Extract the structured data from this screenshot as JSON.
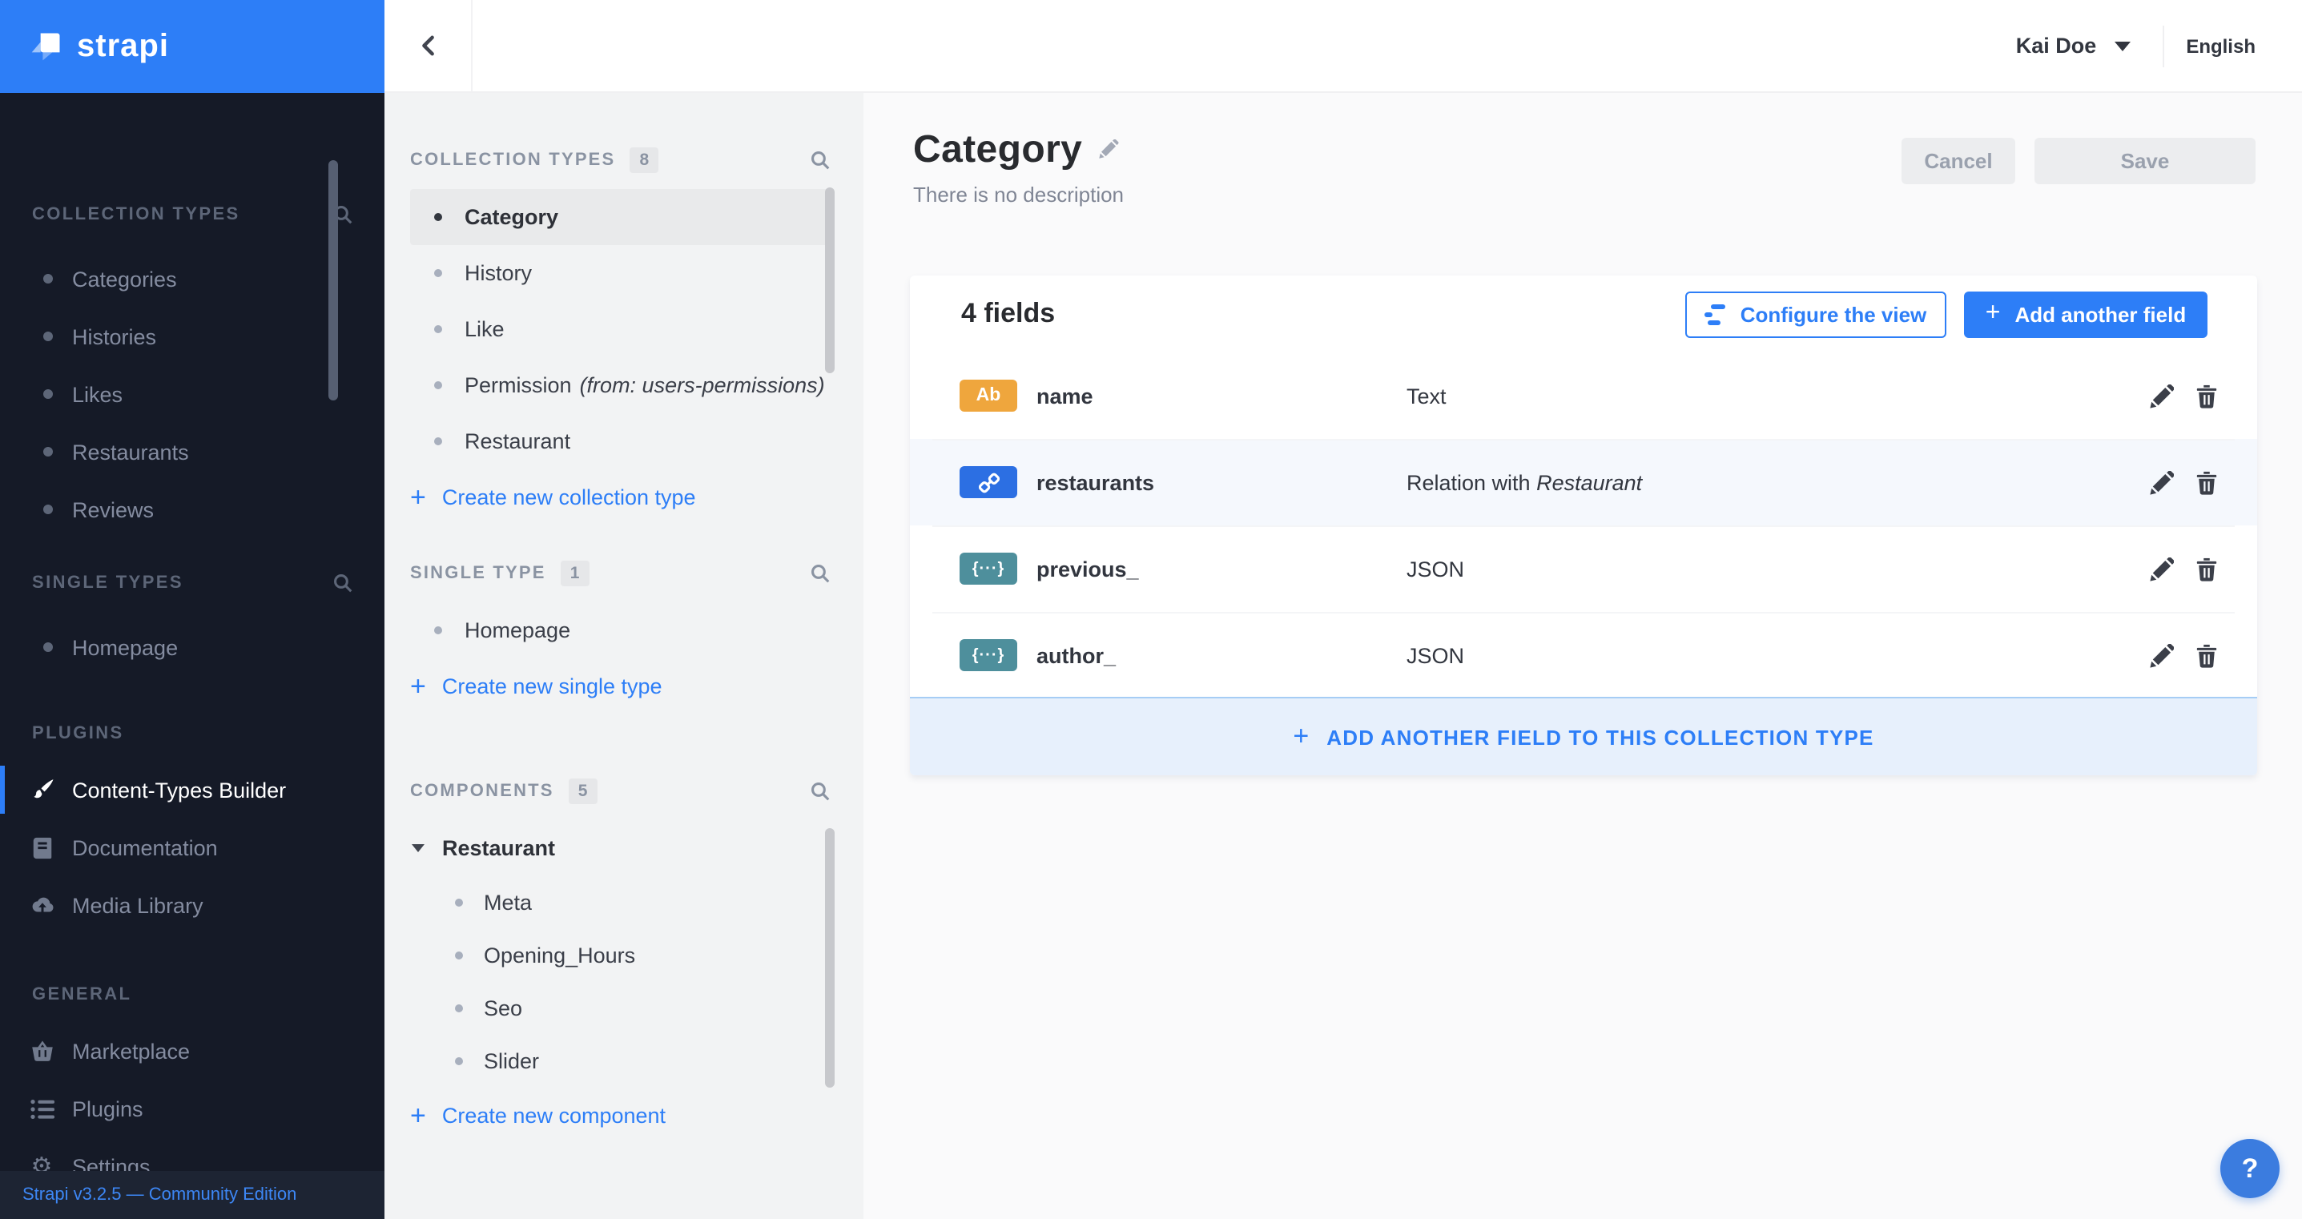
{
  "colors": {
    "accent_blue": "#2d7ef7",
    "dark_sidebar_bg": "#151a27",
    "builder_sidebar_bg": "#f2f3f4",
    "main_bg": "#fafafb",
    "badge_text_field": "#efa63d",
    "badge_relation": "#2c6fe3",
    "badge_json": "#4e8f9c"
  },
  "app_sidebar": {
    "logo_text": "strapi",
    "sections": [
      {
        "title": "COLLECTION TYPES",
        "items": [
          "Categories",
          "Histories",
          "Likes",
          "Restaurants",
          "Reviews"
        ]
      },
      {
        "title": "SINGLE TYPES",
        "items": [
          "Homepage"
        ]
      },
      {
        "title": "PLUGINS",
        "items": [
          {
            "label": "Content-Types Builder",
            "icon": "brush",
            "active": true
          },
          {
            "label": "Documentation",
            "icon": "book"
          },
          {
            "label": "Media Library",
            "icon": "cloud-upload"
          }
        ]
      },
      {
        "title": "GENERAL",
        "items": [
          {
            "label": "Marketplace",
            "icon": "basket"
          },
          {
            "label": "Plugins",
            "icon": "list"
          },
          {
            "label": "Settings",
            "icon": "gear"
          }
        ]
      }
    ],
    "footer": "Strapi v3.2.5 — Community Edition"
  },
  "topbar": {
    "user": "Kai Doe",
    "language": "English"
  },
  "builder": {
    "collection": {
      "title": "COLLECTION TYPES",
      "count": "8",
      "items": [
        {
          "label": "Category",
          "active": true
        },
        {
          "label": "History"
        },
        {
          "label": "Like"
        },
        {
          "label": "Permission",
          "note": "(from: users-permissions)"
        },
        {
          "label": "Restaurant"
        }
      ],
      "create": "Create new collection type"
    },
    "single": {
      "title": "SINGLE TYPE",
      "count": "1",
      "items": [
        {
          "label": "Homepage"
        }
      ],
      "create": "Create new single type"
    },
    "components": {
      "title": "COMPONENTS",
      "count": "5",
      "group": "Restaurant",
      "items": [
        {
          "label": "Meta"
        },
        {
          "label": "Opening_Hours"
        },
        {
          "label": "Seo"
        },
        {
          "label": "Slider"
        }
      ],
      "create": "Create new component"
    }
  },
  "main": {
    "title": "Category",
    "subtitle": "There is no description",
    "cancel_label": "Cancel",
    "save_label": "Save",
    "fields_count": "4 fields",
    "configure_label": "Configure the view",
    "add_field_label": "Add another field",
    "rows": [
      {
        "badge": "Ab",
        "badge_type": "text",
        "name": "name",
        "type": "Text"
      },
      {
        "badge_type": "relation",
        "name": "restaurants",
        "type": "Relation with ",
        "type_italic": "Restaurant"
      },
      {
        "badge": "{···}",
        "badge_type": "json",
        "name": "previous_",
        "type": "JSON"
      },
      {
        "badge": "{···}",
        "badge_type": "json",
        "name": "author_",
        "type": "JSON"
      }
    ],
    "footer_cta": "ADD ANOTHER FIELD TO THIS COLLECTION TYPE"
  },
  "help": {
    "label": "?"
  }
}
